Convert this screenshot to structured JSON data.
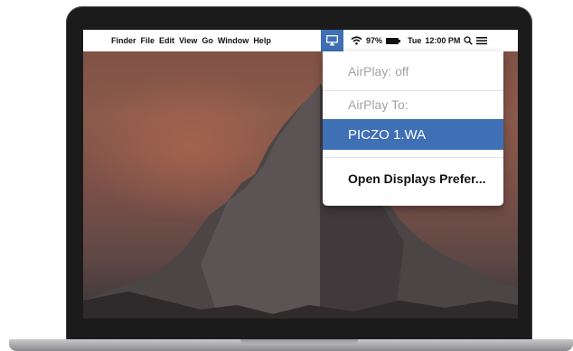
{
  "menubar": {
    "app_menus": [
      "Finder",
      "File",
      "Edit",
      "View",
      "Go",
      "Window",
      "Help"
    ],
    "battery": "97%",
    "day": "Tue",
    "time": "12:00 PM",
    "icons": [
      "airplay-icon",
      "wifi-icon",
      "battery-icon",
      "spotlight-search-icon",
      "notification-center-icon"
    ]
  },
  "airplay_menu": {
    "status": "AirPlay: off",
    "section_header": "AirPlay To:",
    "device": "PICZO 1.WA",
    "open_prefs": "Open Displays Prefer..."
  },
  "colors": {
    "accent": "#3f6fb5",
    "bezel": "#1b1b1b",
    "disabled_text": "#a3a3a3"
  }
}
